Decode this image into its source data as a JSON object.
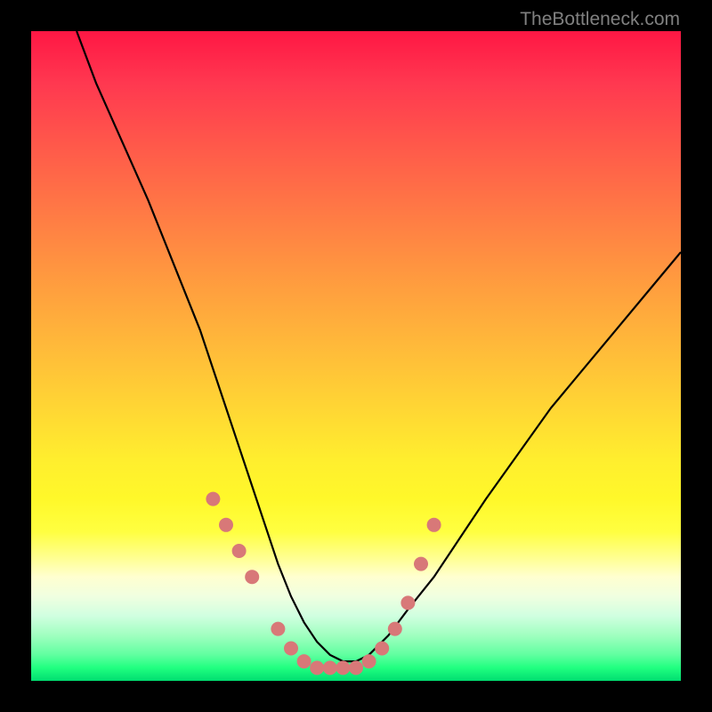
{
  "watermark": "TheBottleneck.com",
  "chart_data": {
    "type": "line",
    "title": "",
    "xlabel": "",
    "ylabel": "",
    "xlim": [
      0,
      100
    ],
    "ylim": [
      0,
      100
    ],
    "curve": {
      "x": [
        7,
        10,
        14,
        18,
        22,
        26,
        28,
        30,
        32,
        34,
        36,
        38,
        40,
        42,
        44,
        46,
        48,
        50,
        52,
        55,
        58,
        62,
        66,
        70,
        75,
        80,
        85,
        90,
        95,
        100
      ],
      "y": [
        100,
        92,
        83,
        74,
        64,
        54,
        48,
        42,
        36,
        30,
        24,
        18,
        13,
        9,
        6,
        4,
        3,
        3,
        4,
        7,
        11,
        16,
        22,
        28,
        35,
        42,
        48,
        54,
        60,
        66
      ]
    },
    "markers": {
      "x": [
        28,
        30,
        32,
        34,
        38,
        40,
        42,
        44,
        46,
        48,
        50,
        52,
        54,
        56,
        58,
        60,
        62
      ],
      "y": [
        28,
        24,
        20,
        16,
        8,
        5,
        3,
        2,
        2,
        2,
        2,
        3,
        5,
        8,
        12,
        18,
        24
      ],
      "color": "#d87878",
      "radius": 8
    },
    "curve_color": "#000000"
  }
}
